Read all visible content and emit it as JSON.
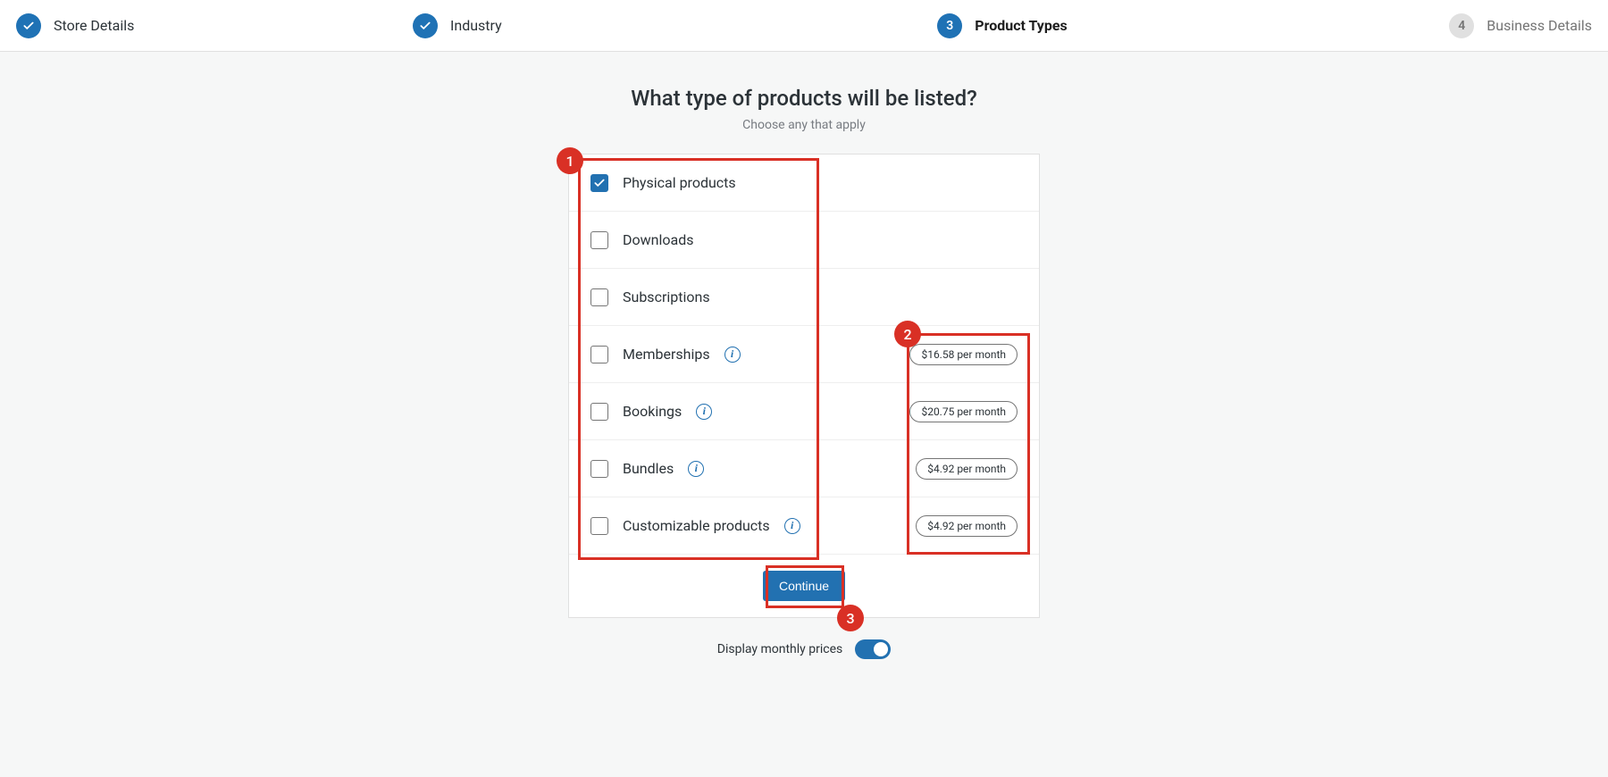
{
  "stepper": {
    "steps": [
      {
        "label": "Store Details",
        "state": "done"
      },
      {
        "label": "Industry",
        "state": "done"
      },
      {
        "label": "Product Types",
        "state": "active",
        "number": "3"
      },
      {
        "label": "Business Details",
        "state": "upcoming",
        "number": "4"
      }
    ]
  },
  "heading": {
    "title": "What type of products will be listed?",
    "subtitle": "Choose any that apply"
  },
  "options": [
    {
      "label": "Physical products",
      "checked": true,
      "info": false,
      "price": ""
    },
    {
      "label": "Downloads",
      "checked": false,
      "info": false,
      "price": ""
    },
    {
      "label": "Subscriptions",
      "checked": false,
      "info": false,
      "price": ""
    },
    {
      "label": "Memberships",
      "checked": false,
      "info": true,
      "price": "$16.58 per month"
    },
    {
      "label": "Bookings",
      "checked": false,
      "info": true,
      "price": "$20.75 per month"
    },
    {
      "label": "Bundles",
      "checked": false,
      "info": true,
      "price": "$4.92 per month"
    },
    {
      "label": "Customizable products",
      "checked": false,
      "info": true,
      "price": "$4.92 per month"
    }
  ],
  "buttons": {
    "continue": "Continue"
  },
  "toggle": {
    "label": "Display monthly prices",
    "on": true
  },
  "annotations": {
    "badge1": "1",
    "badge2": "2",
    "badge3": "3"
  }
}
